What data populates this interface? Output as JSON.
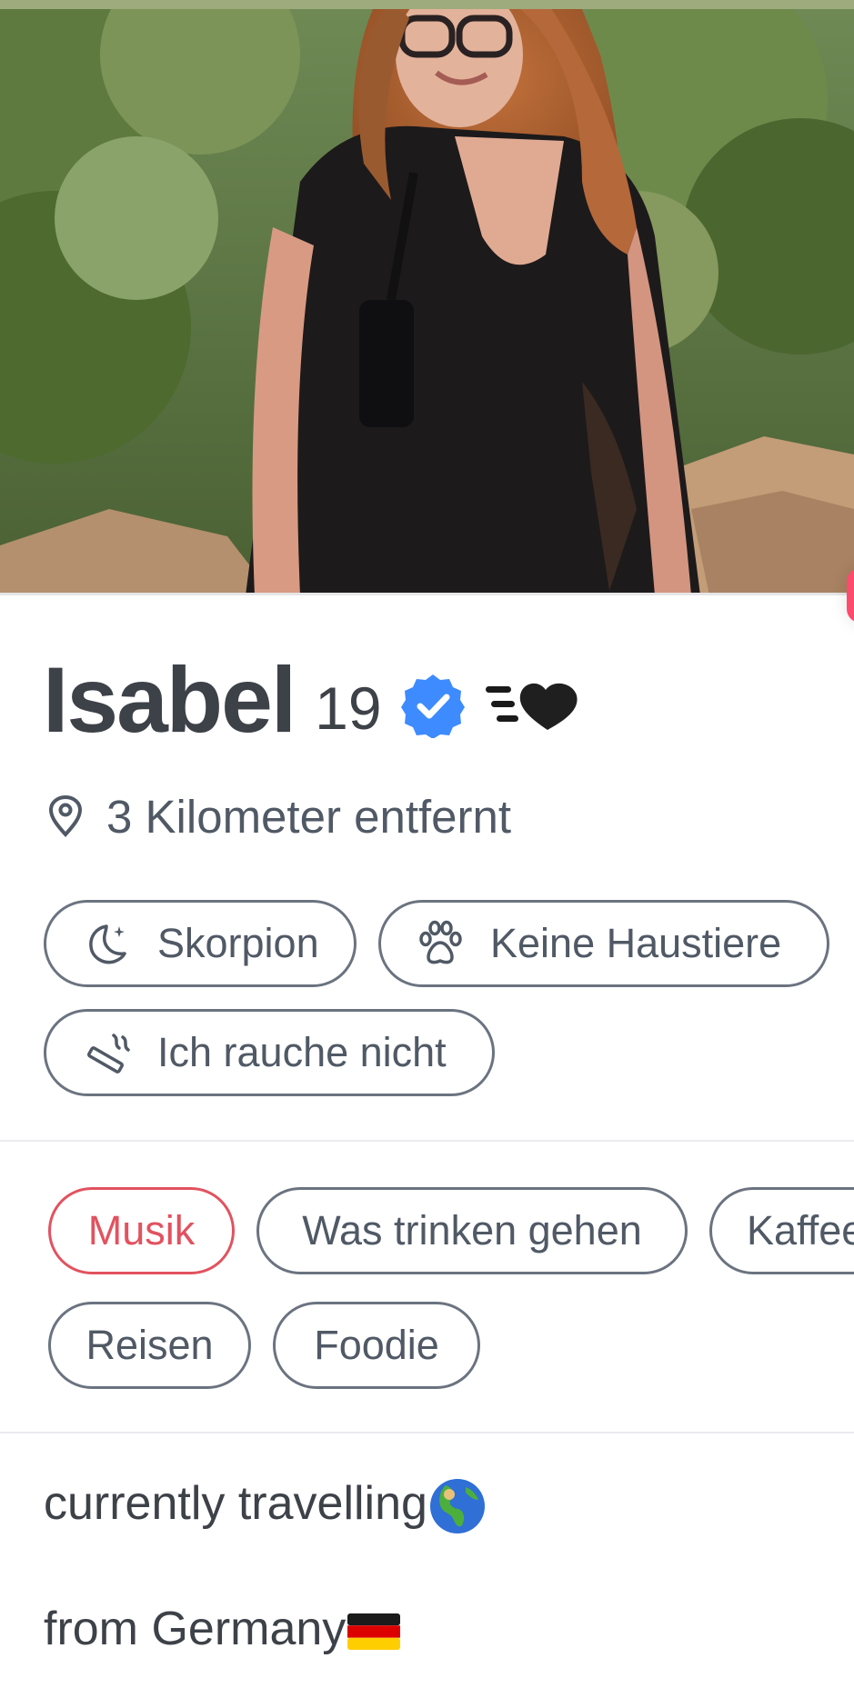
{
  "profile": {
    "name": "Isabel",
    "age": "19",
    "distance": "3 Kilometer entfernt"
  },
  "basics": [
    {
      "icon": "zodiac-moon-icon",
      "label": "Skorpion"
    },
    {
      "icon": "paw-icon",
      "label": "Keine Haustiere"
    },
    {
      "icon": "smoking-icon",
      "label": "Ich rauche nicht"
    }
  ],
  "interests": [
    {
      "label": "Musik",
      "selected": true
    },
    {
      "label": "Was trinken gehen",
      "selected": false
    },
    {
      "label": "Kaffee",
      "selected": false
    },
    {
      "label": "Reisen",
      "selected": false
    },
    {
      "label": "Foodie",
      "selected": false
    }
  ],
  "bio": {
    "line1": "currently travelling",
    "line2": "from Germany"
  },
  "colors": {
    "accent": "#e2525f",
    "verified": "#3d8bff",
    "text": "#505965"
  }
}
